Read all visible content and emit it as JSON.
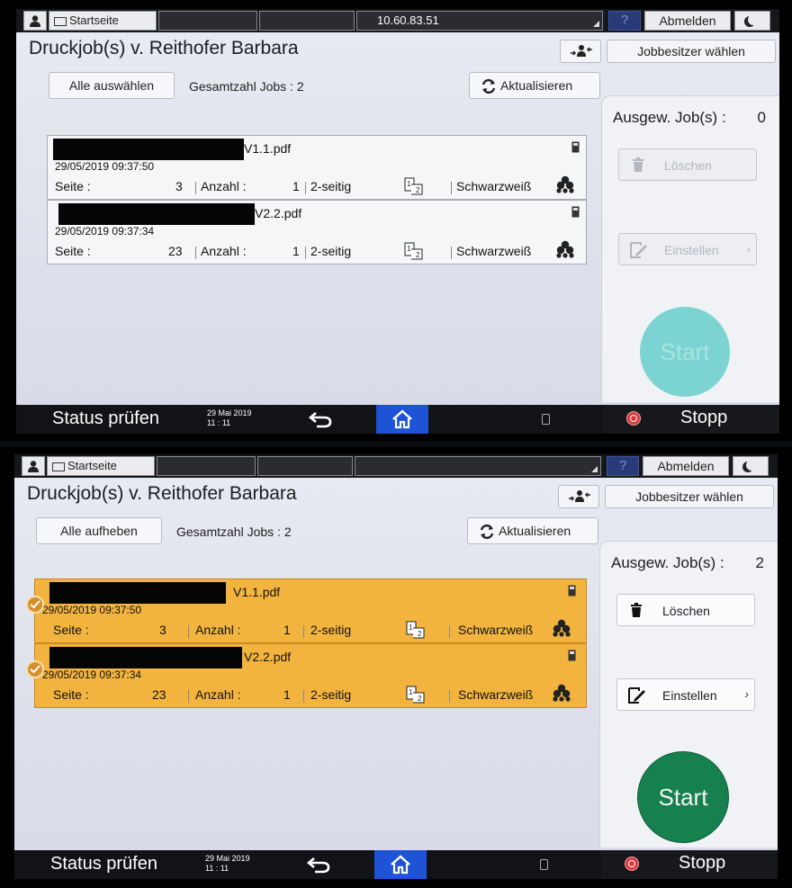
{
  "screens": [
    {
      "topbar": {
        "home": "Startseite",
        "ip": "10.60.83.51",
        "help": "?",
        "logout": "Abmelden"
      },
      "title": "Druckjob(s) v. Reithofer Barbara",
      "owner_button": "Jobbesitzer wählen",
      "select_button": "Alle auswählen",
      "total_jobs": "Gesamtzahl Jobs : 2",
      "refresh_button": "Aktualisieren",
      "selected_label": "Ausgew. Job(s) :",
      "selected_count": "0",
      "delete_button": "Löschen",
      "settings_button": "Einstellen",
      "start_button": "Start",
      "jobs": [
        {
          "filename": "V1.1.pdf",
          "datetime": "29/05/2019 09:37:50",
          "page_label": "Seite :",
          "pages": "3",
          "copies_label": "Anzahl :",
          "copies": "1",
          "duplex": "2-seitig",
          "color_mode": "Schwarzweiß",
          "selected": false
        },
        {
          "filename": "V2.2.pdf",
          "datetime": "29/05/2019 09:37:34",
          "page_label": "Seite :",
          "pages": "23",
          "copies_label": "Anzahl :",
          "copies": "1",
          "duplex": "2-seitig",
          "color_mode": "Schwarzweiß",
          "selected": false
        }
      ],
      "bottom": {
        "status": "Status prüfen",
        "date": "29 Mai 2019",
        "time": "11 : 11",
        "stop": "Stopp"
      }
    },
    {
      "topbar": {
        "home": "Startseite",
        "ip": "",
        "help": "?",
        "logout": "Abmelden"
      },
      "title": "Druckjob(s) v. Reithofer Barbara",
      "owner_button": "Jobbesitzer wählen",
      "select_button": "Alle aufheben",
      "total_jobs": "Gesamtzahl Jobs : 2",
      "refresh_button": "Aktualisieren",
      "selected_label": "Ausgew. Job(s) :",
      "selected_count": "2",
      "delete_button": "Löschen",
      "settings_button": "Einstellen",
      "start_button": "Start",
      "jobs": [
        {
          "filename": "V1.1.pdf",
          "datetime": "29/05/2019 09:37:50",
          "page_label": "Seite :",
          "pages": "3",
          "copies_label": "Anzahl :",
          "copies": "1",
          "duplex": "2-seitig",
          "color_mode": "Schwarzweiß",
          "selected": true
        },
        {
          "filename": "V2.2.pdf",
          "datetime": "29/05/2019 09:37:34",
          "page_label": "Seite :",
          "pages": "23",
          "copies_label": "Anzahl :",
          "copies": "1",
          "duplex": "2-seitig",
          "color_mode": "Schwarzweiß",
          "selected": true
        }
      ],
      "bottom": {
        "status": "Status prüfen",
        "date": "29 Mai 2019",
        "time": "11 : 11",
        "stop": "Stopp"
      }
    }
  ]
}
